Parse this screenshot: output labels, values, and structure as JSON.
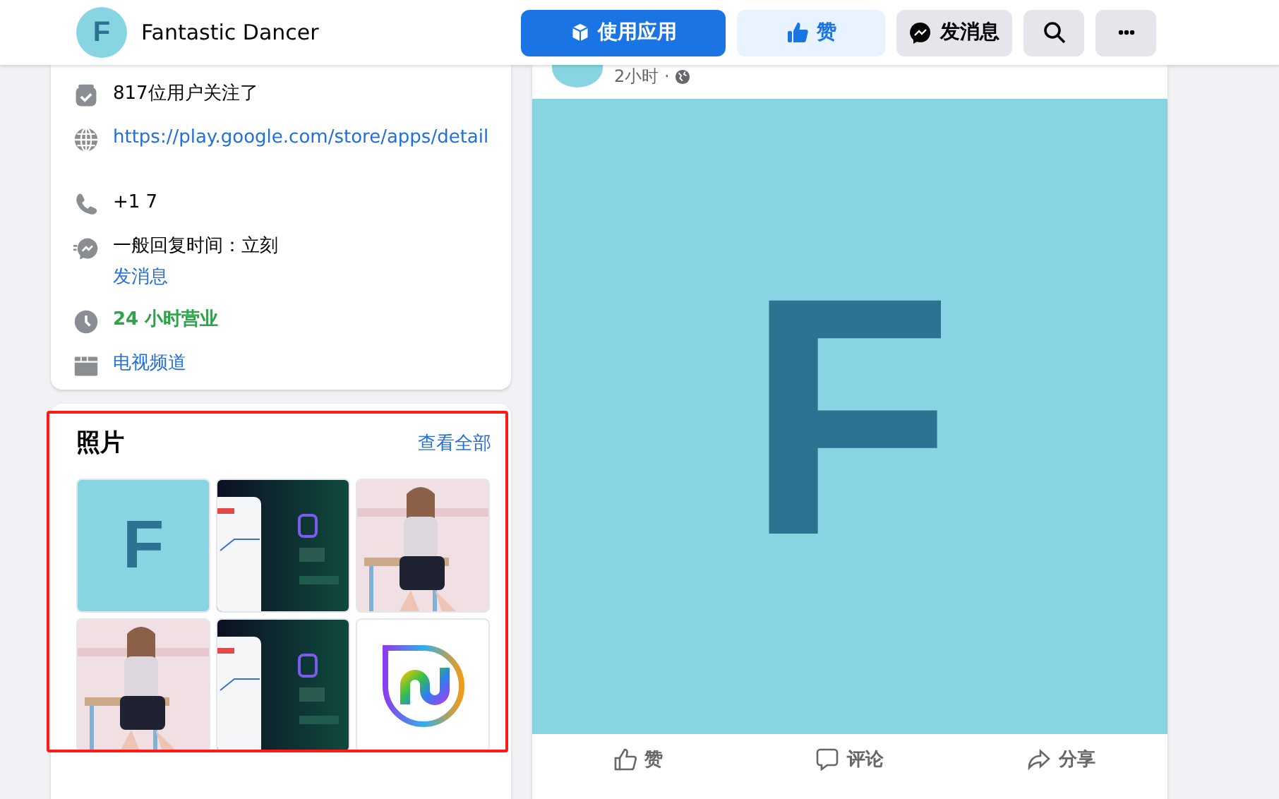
{
  "header": {
    "avatar_letter": "F",
    "page_name": "Fantastic Dancer",
    "buttons": [
      {
        "kind": "primary",
        "label": "使用应用"
      },
      {
        "kind": "like",
        "label": "赞"
      },
      {
        "kind": "message",
        "label": "发消息"
      },
      {
        "kind": "search"
      },
      {
        "kind": "more"
      }
    ]
  },
  "about": {
    "items": [
      {
        "kind": "followers",
        "lines": [
          "817位用户关注了"
        ]
      },
      {
        "kind": "website",
        "lines": [
          "https://play.google.com/store/apps/detail"
        ]
      },
      {
        "kind": "phone",
        "lines": [
          "+1 7"
        ]
      },
      {
        "kind": "response",
        "lines": [
          "一般回复时间：立刻",
          "发消息"
        ]
      },
      {
        "kind": "hours",
        "lines": [
          "24 小时营业"
        ]
      },
      {
        "kind": "category",
        "lines": [
          "电视频道"
        ]
      }
    ]
  },
  "photos": {
    "title": "照片",
    "see_all": "查看全部",
    "items": [
      {
        "kind": "letter",
        "letter": "F"
      },
      {
        "kind": "picture"
      },
      {
        "kind": "picture"
      },
      {
        "kind": "picture"
      },
      {
        "kind": "picture"
      },
      {
        "kind": "logo"
      }
    ]
  },
  "post": {
    "time": "2小时 ·",
    "image_letter": "F",
    "actions": [
      {
        "kind": "like",
        "label": "赞"
      },
      {
        "kind": "comment",
        "label": "评论"
      },
      {
        "kind": "share",
        "label": "分享"
      }
    ]
  }
}
